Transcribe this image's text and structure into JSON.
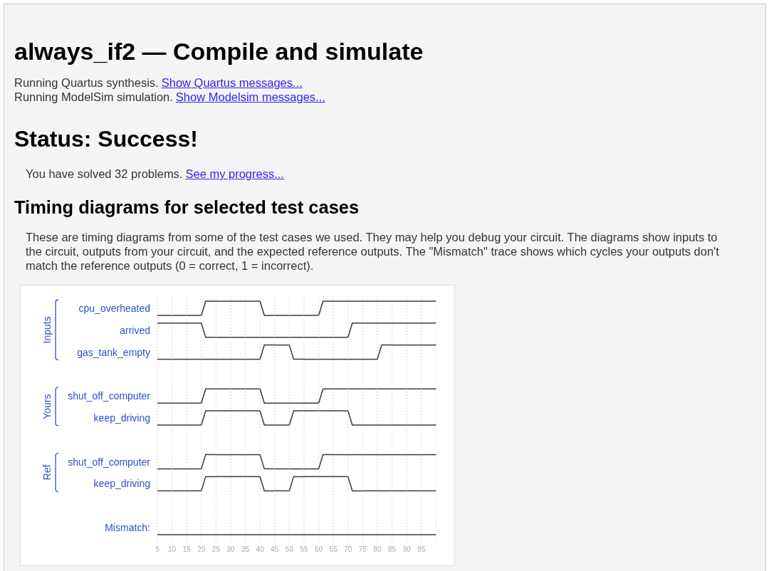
{
  "title": "always_if2 — Compile and simulate",
  "log": [
    {
      "text": "Running Quartus synthesis.",
      "link": "Show Quartus messages..."
    },
    {
      "text": "Running ModelSim simulation.",
      "link": "Show Modelsim messages..."
    }
  ],
  "status": {
    "heading": "Status: Success!",
    "text": "You have solved 32 problems.",
    "link": "See my progress..."
  },
  "section": {
    "heading": "Timing diagrams for selected test cases",
    "description": "These are timing diagrams from some of the test cases we used. They may help you debug your circuit. The diagrams show inputs to the circuit, outputs from your circuit, and the expected reference outputs. The \"Mismatch\" trace shows which cycles your outputs don't match the reference outputs (0 = correct, 1 = incorrect)."
  },
  "timing_diagram": {
    "ticks": [
      "5",
      "10",
      "15",
      "20",
      "25",
      "30",
      "35",
      "40",
      "45",
      "50",
      "55",
      "60",
      "65",
      "70",
      "75",
      "80",
      "85",
      "90",
      "95"
    ],
    "groups": [
      {
        "label": "Inputs",
        "signals": [
          {
            "name": "cpu_overheated",
            "high": [
              false,
              false,
              false,
              true,
              true,
              true,
              true,
              false,
              false,
              false,
              false,
              true,
              true,
              true,
              true,
              true,
              true,
              true,
              true
            ]
          },
          {
            "name": "arrived",
            "high": [
              true,
              true,
              true,
              false,
              false,
              false,
              false,
              false,
              false,
              false,
              false,
              false,
              false,
              true,
              true,
              true,
              true,
              true,
              true
            ]
          },
          {
            "name": "gas_tank_empty",
            "high": [
              false,
              false,
              false,
              false,
              false,
              false,
              false,
              true,
              true,
              false,
              false,
              false,
              false,
              false,
              false,
              true,
              true,
              true,
              true
            ]
          }
        ]
      },
      {
        "label": "Yours",
        "signals": [
          {
            "name": "shut_off_computer",
            "high": [
              false,
              false,
              false,
              true,
              true,
              true,
              true,
              false,
              false,
              false,
              false,
              true,
              true,
              true,
              true,
              true,
              true,
              true,
              true
            ]
          },
          {
            "name": "keep_driving",
            "high": [
              false,
              false,
              false,
              true,
              true,
              true,
              true,
              false,
              false,
              true,
              true,
              true,
              true,
              false,
              false,
              false,
              false,
              false,
              false
            ]
          }
        ]
      },
      {
        "label": "Ref",
        "signals": [
          {
            "name": "shut_off_computer",
            "high": [
              false,
              false,
              false,
              true,
              true,
              true,
              true,
              false,
              false,
              false,
              false,
              true,
              true,
              true,
              true,
              true,
              true,
              true,
              true
            ]
          },
          {
            "name": "keep_driving",
            "high": [
              false,
              false,
              false,
              true,
              true,
              true,
              true,
              false,
              false,
              true,
              true,
              true,
              true,
              false,
              false,
              false,
              false,
              false,
              false
            ]
          }
        ]
      }
    ],
    "mismatch": {
      "name": "Mismatch:",
      "high": [
        false,
        false,
        false,
        false,
        false,
        false,
        false,
        false,
        false,
        false,
        false,
        false,
        false,
        false,
        false,
        false,
        false,
        false,
        false
      ]
    }
  }
}
